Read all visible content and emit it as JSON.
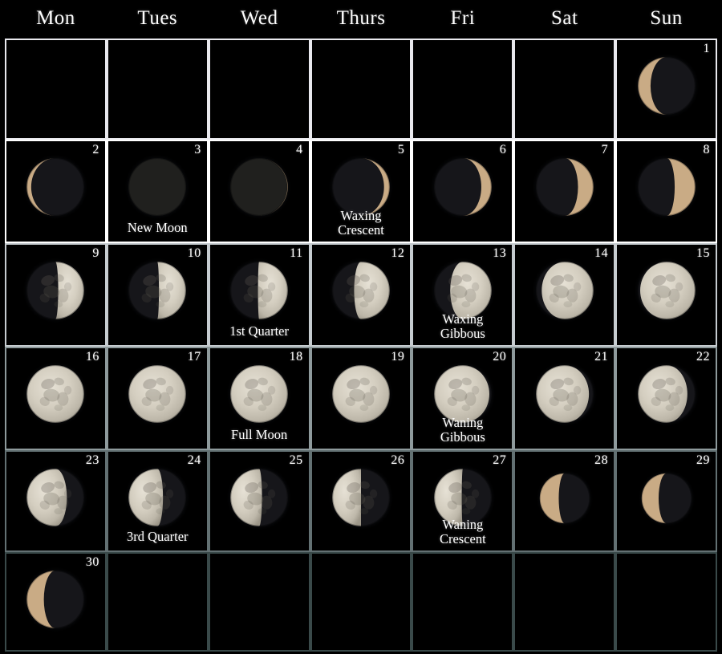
{
  "calendar": {
    "weekday_headers": [
      "Mon",
      "Tues",
      "Wed",
      "Thurs",
      "Fri",
      "Sat",
      "Sun"
    ],
    "background_color": "#000000",
    "text_color": "#ffffff",
    "moon_lit_color": "#d8d2c4",
    "moon_crescent_color": "#c9ab85",
    "moon_dark_color": "#141414",
    "grid_line_color_top": "#ffffff",
    "grid_line_color_bottom": "#3a4a4a",
    "rows": 6,
    "columns": 7,
    "leading_blank_cells": 6,
    "trailing_blank_cells": 6,
    "days_in_month": 30,
    "days": [
      {
        "number": "1",
        "illumination": 0.22,
        "waxing": false,
        "label": "",
        "label2": "",
        "size": "large"
      },
      {
        "number": "2",
        "illumination": 0.08,
        "waxing": false,
        "label": "",
        "label2": "",
        "size": "large"
      },
      {
        "number": "3",
        "illumination": 0.0,
        "waxing": true,
        "label": "New Moon",
        "label2": "",
        "size": "large"
      },
      {
        "number": "4",
        "illumination": 0.01,
        "waxing": true,
        "label": "",
        "label2": "",
        "size": "large"
      },
      {
        "number": "5",
        "illumination": 0.1,
        "waxing": true,
        "label": "Waxing",
        "label2": "Crescent",
        "size": "large"
      },
      {
        "number": "6",
        "illumination": 0.18,
        "waxing": true,
        "label": "",
        "label2": "",
        "size": "large"
      },
      {
        "number": "7",
        "illumination": 0.27,
        "waxing": true,
        "label": "",
        "label2": "",
        "size": "large"
      },
      {
        "number": "8",
        "illumination": 0.36,
        "waxing": true,
        "label": "",
        "label2": "",
        "size": "large"
      },
      {
        "number": "9",
        "illumination": 0.45,
        "waxing": true,
        "label": "",
        "label2": "",
        "size": "large"
      },
      {
        "number": "10",
        "illumination": 0.47,
        "waxing": true,
        "label": "",
        "label2": "",
        "size": "large"
      },
      {
        "number": "11",
        "illumination": 0.52,
        "waxing": true,
        "label": "1st Quarter",
        "label2": "",
        "size": "large"
      },
      {
        "number": "12",
        "illumination": 0.62,
        "waxing": true,
        "label": "",
        "label2": "",
        "size": "large"
      },
      {
        "number": "13",
        "illumination": 0.72,
        "waxing": true,
        "label": "Waxing",
        "label2": "Gibbous",
        "size": "large"
      },
      {
        "number": "14",
        "illumination": 0.9,
        "waxing": true,
        "label": "",
        "label2": "",
        "size": "large"
      },
      {
        "number": "15",
        "illumination": 0.96,
        "waxing": true,
        "label": "",
        "label2": "",
        "size": "large"
      },
      {
        "number": "16",
        "illumination": 0.99,
        "waxing": true,
        "label": "",
        "label2": "",
        "size": "large"
      },
      {
        "number": "17",
        "illumination": 1.0,
        "waxing": true,
        "label": "",
        "label2": "",
        "size": "large"
      },
      {
        "number": "18",
        "illumination": 1.0,
        "waxing": false,
        "label": "Full Moon",
        "label2": "",
        "size": "large"
      },
      {
        "number": "19",
        "illumination": 0.99,
        "waxing": false,
        "label": "",
        "label2": "",
        "size": "large"
      },
      {
        "number": "20",
        "illumination": 0.96,
        "waxing": false,
        "label": "Waning",
        "label2": "Gibbous",
        "size": "large"
      },
      {
        "number": "21",
        "illumination": 0.92,
        "waxing": false,
        "label": "",
        "label2": "",
        "size": "large"
      },
      {
        "number": "22",
        "illumination": 0.86,
        "waxing": false,
        "label": "",
        "label2": "",
        "size": "large"
      },
      {
        "number": "23",
        "illumination": 0.7,
        "waxing": false,
        "label": "",
        "label2": "",
        "size": "large"
      },
      {
        "number": "24",
        "illumination": 0.6,
        "waxing": false,
        "label": "3rd Quarter",
        "label2": "",
        "size": "large"
      },
      {
        "number": "25",
        "illumination": 0.55,
        "waxing": false,
        "label": "",
        "label2": "",
        "size": "large"
      },
      {
        "number": "26",
        "illumination": 0.5,
        "waxing": false,
        "label": "",
        "label2": "",
        "size": "large"
      },
      {
        "number": "27",
        "illumination": 0.48,
        "waxing": false,
        "label": "Waning",
        "label2": "Crescent",
        "size": "large"
      },
      {
        "number": "28",
        "illumination": 0.38,
        "waxing": false,
        "label": "",
        "label2": "",
        "size": "small"
      },
      {
        "number": "29",
        "illumination": 0.34,
        "waxing": false,
        "label": "",
        "label2": "",
        "size": "small"
      },
      {
        "number": "30",
        "illumination": 0.3,
        "waxing": false,
        "label": "",
        "label2": "",
        "size": "large"
      }
    ]
  }
}
